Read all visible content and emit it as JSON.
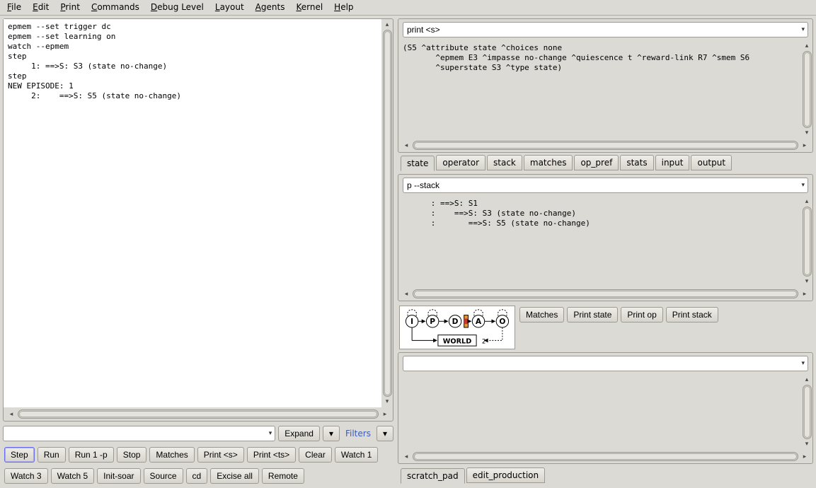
{
  "menu": {
    "file": "File",
    "edit": "Edit",
    "print": "Print",
    "commands": "Commands",
    "debug": "Debug Level",
    "layout": "Layout",
    "agents": "Agents",
    "kernel": "Kernel",
    "help": "Help"
  },
  "left_output": "epmem --set trigger dc\nepmem --set learning on\nwatch --epmem\nstep\n     1: ==>S: S3 (state no-change)\nstep\nNEW EPISODE: 1\n     2:    ==>S: S5 (state no-change)",
  "left_combo": "",
  "left_buttons": {
    "expand": "Expand",
    "filters": "Filters"
  },
  "cmd_row1": [
    "Step",
    "Run",
    "Run 1 -p",
    "Stop",
    "Matches",
    "Print <s>",
    "Print <ts>",
    "Clear",
    "Watch 1"
  ],
  "cmd_row2": [
    "Watch 3",
    "Watch 5",
    "Init-soar",
    "Source",
    "cd",
    "Excise all",
    "Remote"
  ],
  "top_right": {
    "combo": "print <s>",
    "output": "(S5 ^attribute state ^choices none\n       ^epmem E3 ^impasse no-change ^quiescence t ^reward-link R7 ^smem S6\n       ^superstate S3 ^type state)"
  },
  "right_tabs": [
    "state",
    "operator",
    "stack",
    "matches",
    "op_pref",
    "stats",
    "input",
    "output"
  ],
  "mid_right": {
    "combo": "p --stack",
    "output": "      : ==>S: S1\n      :    ==>S: S3 (state no-change)\n      :       ==>S: S5 (state no-change)"
  },
  "diagram_buttons": [
    "Matches",
    "Print state",
    "Print op",
    "Print stack"
  ],
  "diagram_labels": {
    "world": "WORLD"
  },
  "bottom_combo": "",
  "bottom_tabs": [
    "scratch_pad",
    "edit_production"
  ]
}
